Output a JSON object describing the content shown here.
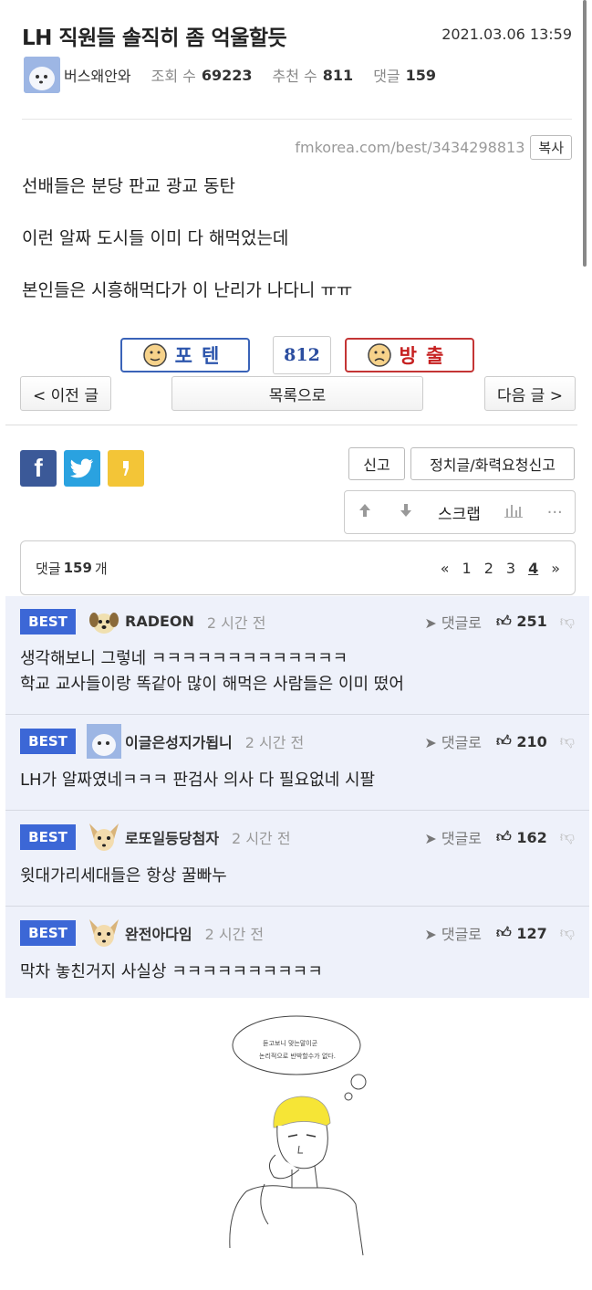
{
  "post": {
    "title": "LH 직원들 솔직히 좀 억울할듯",
    "date": "2021.03.06 13:59",
    "author": "버스왜안와",
    "views_label": "조회 수",
    "views": "69223",
    "recommend_label": "추천 수",
    "recommend": "811",
    "comments_label": "댓글",
    "comments": "159",
    "url": "fmkorea.com/best/3434298813",
    "copy_label": "복사",
    "lines": [
      "선배들은 분당 판교 광교 동탄",
      "이런 알짜 도시들 이미 다 해먹었는데",
      "본인들은 시흥해먹다가 이 난리가 나다니 ㅠㅠ"
    ]
  },
  "vote": {
    "up_label": "포텐",
    "count": "812",
    "down_label": "방출"
  },
  "nav": {
    "prev": "< 이전 글",
    "list": "목록으로",
    "next": "다음 글 >"
  },
  "actions": {
    "report": "신고",
    "political_report": "정치글/화력요청신고",
    "scrap": "스크랩",
    "more": "···"
  },
  "comment_bar": {
    "prefix": "댓글",
    "count": "159",
    "suffix": "개",
    "pages": [
      "«",
      "1",
      "2",
      "3",
      "4",
      "»"
    ],
    "current_page": "4"
  },
  "comments": [
    {
      "badge": "BEST",
      "name": "RADEON",
      "time": "2 시간 전",
      "reply": "댓글로",
      "likes": "251",
      "lines": [
        "생각해보니 그렇네 ㅋㅋㅋㅋㅋㅋㅋㅋㅋㅋㅋㅋㅋ",
        "학교 교사들이랑 똑같아 많이 해먹은 사람들은 이미 떴어"
      ]
    },
    {
      "badge": "BEST",
      "name": "이글은성지가됩니",
      "time": "2 시간 전",
      "reply": "댓글로",
      "likes": "210",
      "lines": [
        "LH가 알짜였네ㅋㅋㅋ 판검사 의사 다 필요없네 시팔"
      ]
    },
    {
      "badge": "BEST",
      "name": "로또일등당첨자",
      "time": "2 시간 전",
      "reply": "댓글로",
      "likes": "162",
      "lines": [
        "윗대가리세대들은 항상 꿀빠누"
      ]
    },
    {
      "badge": "BEST",
      "name": "완전아다임",
      "time": "2 시간 전",
      "reply": "댓글로",
      "likes": "127",
      "lines": [
        "막차 놓친거지 사실상 ㅋㅋㅋㅋㅋㅋㅋㅋㅋㅋ"
      ]
    }
  ],
  "art": {
    "bubble_line1": "듣고보니 맞는말이군",
    "bubble_line2": "논리적으로 반박할수가 없다."
  },
  "colors": {
    "best_badge": "#3c67d6",
    "comment_bg": "#eef1fa",
    "vote_up": "#2c55ac",
    "vote_down": "#c62020"
  }
}
